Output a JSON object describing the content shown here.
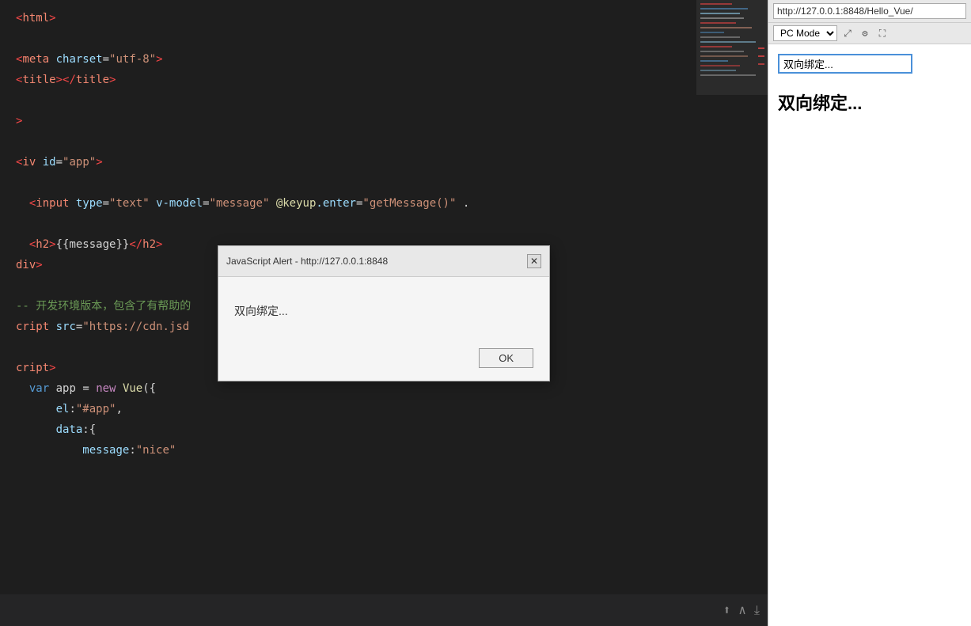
{
  "editor": {
    "lines": [
      {
        "id": "l1",
        "content": "html>"
      },
      {
        "id": "l2",
        "content": ""
      },
      {
        "id": "l3",
        "content": "eta charset=\"utf-8\">"
      },
      {
        "id": "l4",
        "content": "itle></title>"
      },
      {
        "id": "l5",
        "content": ""
      },
      {
        "id": "l6",
        "content": ">"
      },
      {
        "id": "l7",
        "content": ""
      },
      {
        "id": "l8",
        "content": "iv id=\"app\">"
      },
      {
        "id": "l9",
        "content": ""
      },
      {
        "id": "l10",
        "content": " <input type=\"text\" v-model=\"message\" @keyup.enter=\"getMessage()\" ."
      },
      {
        "id": "l11",
        "content": ""
      },
      {
        "id": "l12",
        "content": " <h2>{{message}}</h2>"
      },
      {
        "id": "l13",
        "content": "div>"
      },
      {
        "id": "l14",
        "content": ""
      },
      {
        "id": "l15",
        "content": "-- 开发环境版本，包含了有帮助的"
      },
      {
        "id": "l16",
        "content": "cript src=\"https://cdn.jsd"
      },
      {
        "id": "l17",
        "content": ""
      },
      {
        "id": "l18",
        "content": "cript>"
      },
      {
        "id": "l19",
        "content": "  var app = new Vue({"
      },
      {
        "id": "l20",
        "content": "      el:\"#app\","
      },
      {
        "id": "l21",
        "content": "      data:{"
      },
      {
        "id": "l22",
        "content": "          message:\"nice\""
      }
    ]
  },
  "browser": {
    "url": "http://127.0.0.1:8848/Hello_Vue/",
    "mode": "PC Mode",
    "input_value": "双向绑定...",
    "h2_text": "双向绑定...",
    "icons": {
      "expand": "⤢",
      "settings": "⚙",
      "fullscreen": "⛶"
    }
  },
  "dialog": {
    "title": "JavaScript Alert - http://127.0.0.1:8848",
    "message": "双向绑定...",
    "ok_label": "OK",
    "close_symbol": "✕"
  },
  "bottom_toolbar": {
    "export_icon": "⬆",
    "up_icon": "∧",
    "down_icon": "⤓"
  }
}
